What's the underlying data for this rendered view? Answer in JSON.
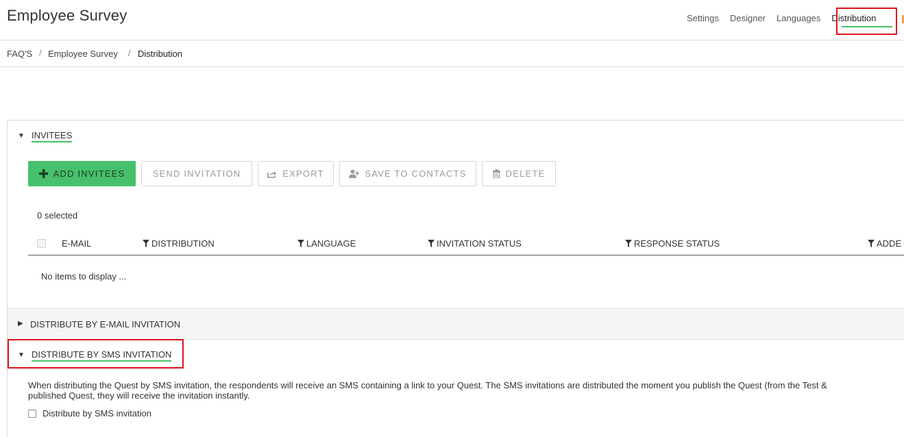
{
  "header": {
    "title": "Employee Survey",
    "nav": [
      {
        "label": "Settings"
      },
      {
        "label": "Designer"
      },
      {
        "label": "Languages"
      },
      {
        "label": "Distribution",
        "active": true
      }
    ]
  },
  "breadcrumb": {
    "items": [
      "FAQ'S",
      "Employee Survey",
      "Distribution"
    ],
    "separator": "/"
  },
  "invitees": {
    "title": "INVITEES",
    "toolbar": {
      "add": "ADD INVITEES",
      "send": "SEND INVITATION",
      "export": "EXPORT",
      "save_contacts": "SAVE TO CONTACTS",
      "delete": "DELETE"
    },
    "selected_count": "0 selected",
    "columns": [
      "E-MAIL",
      "DISTRIBUTION",
      "LANGUAGE",
      "INVITATION STATUS",
      "RESPONSE STATUS",
      "ADDE"
    ],
    "empty_message": "No items to display ..."
  },
  "email_section": {
    "title": "DISTRIBUTE BY E-MAIL INVITATION",
    "expanded": false
  },
  "sms_section": {
    "title": "DISTRIBUTE BY SMS INVITATION",
    "expanded": true,
    "description_line1": "When distributing the Quest by SMS invitation, the respondents will receive an SMS containing a link to your Quest. The SMS invitations are distributed the moment you publish the Quest (from the Test &",
    "description_line2": "published Quest, they will receive the invitation instantly.",
    "checkbox_label": "Distribute by SMS invitation",
    "checkbox_checked": false
  },
  "colors": {
    "accent_green": "#46c06a",
    "highlight_red": "#e0141b"
  }
}
